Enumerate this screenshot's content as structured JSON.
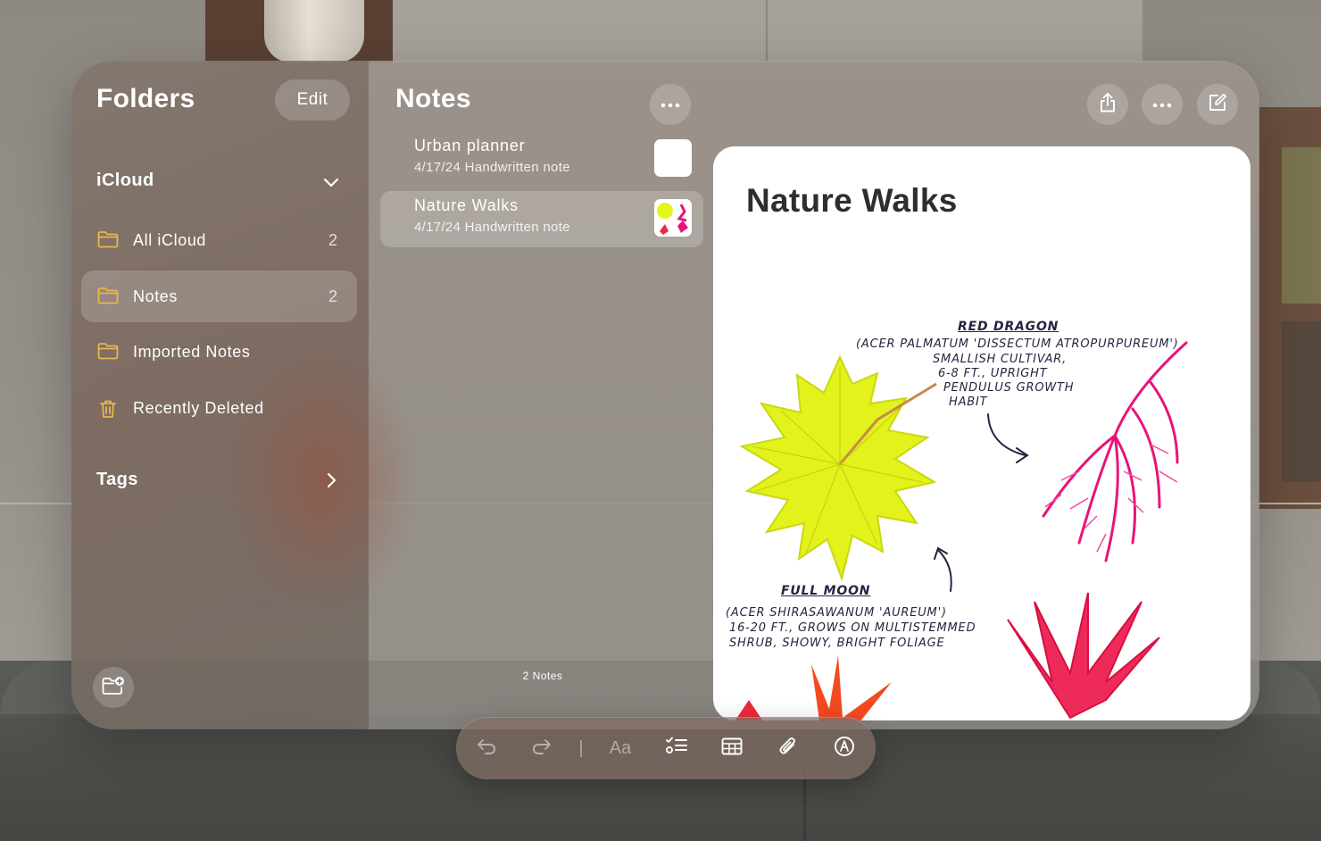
{
  "sidebar": {
    "title": "Folders",
    "edit_label": "Edit",
    "sections": {
      "icloud": {
        "label": "iCloud"
      },
      "tags": {
        "label": "Tags"
      }
    },
    "folders": [
      {
        "label": "All iCloud",
        "count": "2",
        "icon": "folder-icon"
      },
      {
        "label": "Notes",
        "count": "2",
        "icon": "folder-icon",
        "selected": true
      },
      {
        "label": "Imported Notes",
        "count": "",
        "icon": "folder-icon"
      },
      {
        "label": "Recently Deleted",
        "count": "",
        "icon": "trash-icon"
      }
    ]
  },
  "list": {
    "title": "Notes",
    "notes": [
      {
        "title": "Urban planner",
        "meta": "4/17/24 Handwritten note"
      },
      {
        "title": "Nature Walks",
        "meta": "4/17/24 Handwritten note",
        "selected": true
      }
    ],
    "count_label": "2 Notes"
  },
  "note": {
    "title": "Nature Walks",
    "annotations": {
      "red_dragon": {
        "heading": "RED DRAGON",
        "lines": [
          "(ACER PALMATUM 'DISSECTUM ATROPURPUREUM')",
          "SMALLISH CULTIVAR,",
          "6-8 FT., UPRIGHT",
          "PENDULUS GROWTH",
          "HABIT"
        ]
      },
      "full_moon": {
        "heading": "FULL MOON",
        "lines": [
          "(ACER SHIRASAWANUM 'AUREUM')",
          "16-20 FT., GROWS ON MULTISTEMMED",
          "SHRUB, SHOWY, BRIGHT FOLIAGE"
        ]
      }
    }
  },
  "toolbar": {
    "format_label": "Aa",
    "separator": "|"
  },
  "colors": {
    "accent_folder": "#e7b84a",
    "leaf_yellow": "#e6f51a",
    "leaf_pink": "#e8147a",
    "leaf_red": "#ee2a3a"
  }
}
